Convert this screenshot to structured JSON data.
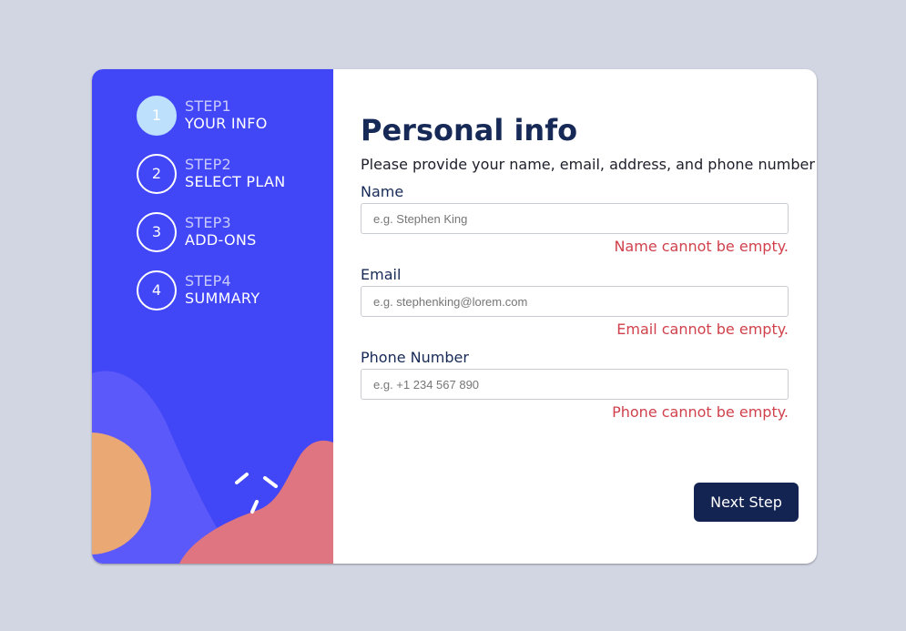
{
  "steps": [
    {
      "small": "STEP1",
      "title": "YOUR INFO",
      "number": "1",
      "active": true
    },
    {
      "small": "STEP2",
      "title": "SELECT PLAN",
      "number": "2",
      "active": false
    },
    {
      "small": "STEP3",
      "title": "ADD-ONS",
      "number": "3",
      "active": false
    },
    {
      "small": "STEP4",
      "title": "SUMMARY",
      "number": "4",
      "active": false
    }
  ],
  "form": {
    "title": "Personal info",
    "subtitle": "Please provide your name, email, address, and phone number",
    "fields": [
      {
        "label": "Name",
        "placeholder": "e.g. Stephen King",
        "value": "",
        "error": "Name cannot be empty."
      },
      {
        "label": "Email",
        "placeholder": "e.g. stephenking@lorem.com",
        "value": "",
        "error": "Email cannot be empty."
      },
      {
        "label": "Phone Number",
        "placeholder": "e.g. +1 234 567 890",
        "value": "",
        "error": "Phone cannot be empty."
      }
    ],
    "next_label": "Next Step"
  },
  "colors": {
    "background": "#d2d6e3",
    "sidebar": "#4146f6",
    "active_step": "#bde0fd",
    "heading": "#172a57",
    "error": "#d0414c",
    "button": "#142452"
  }
}
